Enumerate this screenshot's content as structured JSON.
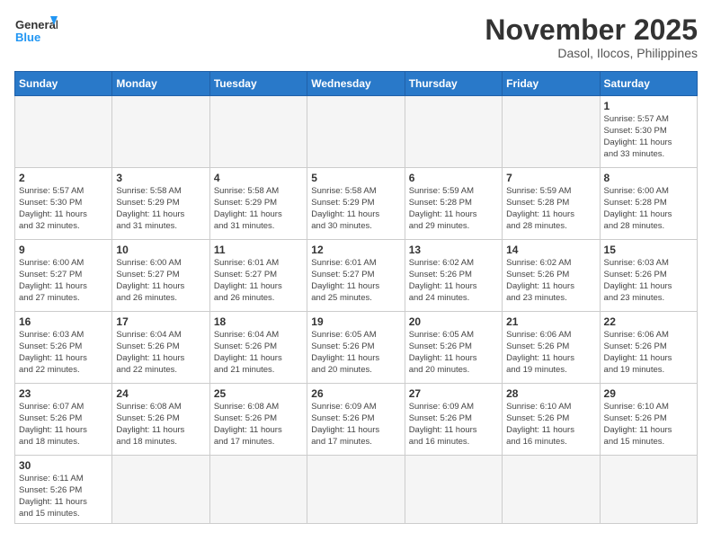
{
  "header": {
    "logo_general": "General",
    "logo_blue": "Blue",
    "month_title": "November 2025",
    "location": "Dasol, Ilocos, Philippines"
  },
  "weekdays": [
    "Sunday",
    "Monday",
    "Tuesday",
    "Wednesday",
    "Thursday",
    "Friday",
    "Saturday"
  ],
  "weeks": [
    [
      {
        "day": "",
        "info": ""
      },
      {
        "day": "",
        "info": ""
      },
      {
        "day": "",
        "info": ""
      },
      {
        "day": "",
        "info": ""
      },
      {
        "day": "",
        "info": ""
      },
      {
        "day": "",
        "info": ""
      },
      {
        "day": "1",
        "info": "Sunrise: 5:57 AM\nSunset: 5:30 PM\nDaylight: 11 hours\nand 33 minutes."
      }
    ],
    [
      {
        "day": "2",
        "info": "Sunrise: 5:57 AM\nSunset: 5:30 PM\nDaylight: 11 hours\nand 32 minutes."
      },
      {
        "day": "3",
        "info": "Sunrise: 5:58 AM\nSunset: 5:29 PM\nDaylight: 11 hours\nand 31 minutes."
      },
      {
        "day": "4",
        "info": "Sunrise: 5:58 AM\nSunset: 5:29 PM\nDaylight: 11 hours\nand 31 minutes."
      },
      {
        "day": "5",
        "info": "Sunrise: 5:58 AM\nSunset: 5:29 PM\nDaylight: 11 hours\nand 30 minutes."
      },
      {
        "day": "6",
        "info": "Sunrise: 5:59 AM\nSunset: 5:28 PM\nDaylight: 11 hours\nand 29 minutes."
      },
      {
        "day": "7",
        "info": "Sunrise: 5:59 AM\nSunset: 5:28 PM\nDaylight: 11 hours\nand 28 minutes."
      },
      {
        "day": "8",
        "info": "Sunrise: 6:00 AM\nSunset: 5:28 PM\nDaylight: 11 hours\nand 28 minutes."
      }
    ],
    [
      {
        "day": "9",
        "info": "Sunrise: 6:00 AM\nSunset: 5:27 PM\nDaylight: 11 hours\nand 27 minutes."
      },
      {
        "day": "10",
        "info": "Sunrise: 6:00 AM\nSunset: 5:27 PM\nDaylight: 11 hours\nand 26 minutes."
      },
      {
        "day": "11",
        "info": "Sunrise: 6:01 AM\nSunset: 5:27 PM\nDaylight: 11 hours\nand 26 minutes."
      },
      {
        "day": "12",
        "info": "Sunrise: 6:01 AM\nSunset: 5:27 PM\nDaylight: 11 hours\nand 25 minutes."
      },
      {
        "day": "13",
        "info": "Sunrise: 6:02 AM\nSunset: 5:26 PM\nDaylight: 11 hours\nand 24 minutes."
      },
      {
        "day": "14",
        "info": "Sunrise: 6:02 AM\nSunset: 5:26 PM\nDaylight: 11 hours\nand 23 minutes."
      },
      {
        "day": "15",
        "info": "Sunrise: 6:03 AM\nSunset: 5:26 PM\nDaylight: 11 hours\nand 23 minutes."
      }
    ],
    [
      {
        "day": "16",
        "info": "Sunrise: 6:03 AM\nSunset: 5:26 PM\nDaylight: 11 hours\nand 22 minutes."
      },
      {
        "day": "17",
        "info": "Sunrise: 6:04 AM\nSunset: 5:26 PM\nDaylight: 11 hours\nand 22 minutes."
      },
      {
        "day": "18",
        "info": "Sunrise: 6:04 AM\nSunset: 5:26 PM\nDaylight: 11 hours\nand 21 minutes."
      },
      {
        "day": "19",
        "info": "Sunrise: 6:05 AM\nSunset: 5:26 PM\nDaylight: 11 hours\nand 20 minutes."
      },
      {
        "day": "20",
        "info": "Sunrise: 6:05 AM\nSunset: 5:26 PM\nDaylight: 11 hours\nand 20 minutes."
      },
      {
        "day": "21",
        "info": "Sunrise: 6:06 AM\nSunset: 5:26 PM\nDaylight: 11 hours\nand 19 minutes."
      },
      {
        "day": "22",
        "info": "Sunrise: 6:06 AM\nSunset: 5:26 PM\nDaylight: 11 hours\nand 19 minutes."
      }
    ],
    [
      {
        "day": "23",
        "info": "Sunrise: 6:07 AM\nSunset: 5:26 PM\nDaylight: 11 hours\nand 18 minutes."
      },
      {
        "day": "24",
        "info": "Sunrise: 6:08 AM\nSunset: 5:26 PM\nDaylight: 11 hours\nand 18 minutes."
      },
      {
        "day": "25",
        "info": "Sunrise: 6:08 AM\nSunset: 5:26 PM\nDaylight: 11 hours\nand 17 minutes."
      },
      {
        "day": "26",
        "info": "Sunrise: 6:09 AM\nSunset: 5:26 PM\nDaylight: 11 hours\nand 17 minutes."
      },
      {
        "day": "27",
        "info": "Sunrise: 6:09 AM\nSunset: 5:26 PM\nDaylight: 11 hours\nand 16 minutes."
      },
      {
        "day": "28",
        "info": "Sunrise: 6:10 AM\nSunset: 5:26 PM\nDaylight: 11 hours\nand 16 minutes."
      },
      {
        "day": "29",
        "info": "Sunrise: 6:10 AM\nSunset: 5:26 PM\nDaylight: 11 hours\nand 15 minutes."
      }
    ],
    [
      {
        "day": "30",
        "info": "Sunrise: 6:11 AM\nSunset: 5:26 PM\nDaylight: 11 hours\nand 15 minutes."
      },
      {
        "day": "",
        "info": ""
      },
      {
        "day": "",
        "info": ""
      },
      {
        "day": "",
        "info": ""
      },
      {
        "day": "",
        "info": ""
      },
      {
        "day": "",
        "info": ""
      },
      {
        "day": "",
        "info": ""
      }
    ]
  ]
}
